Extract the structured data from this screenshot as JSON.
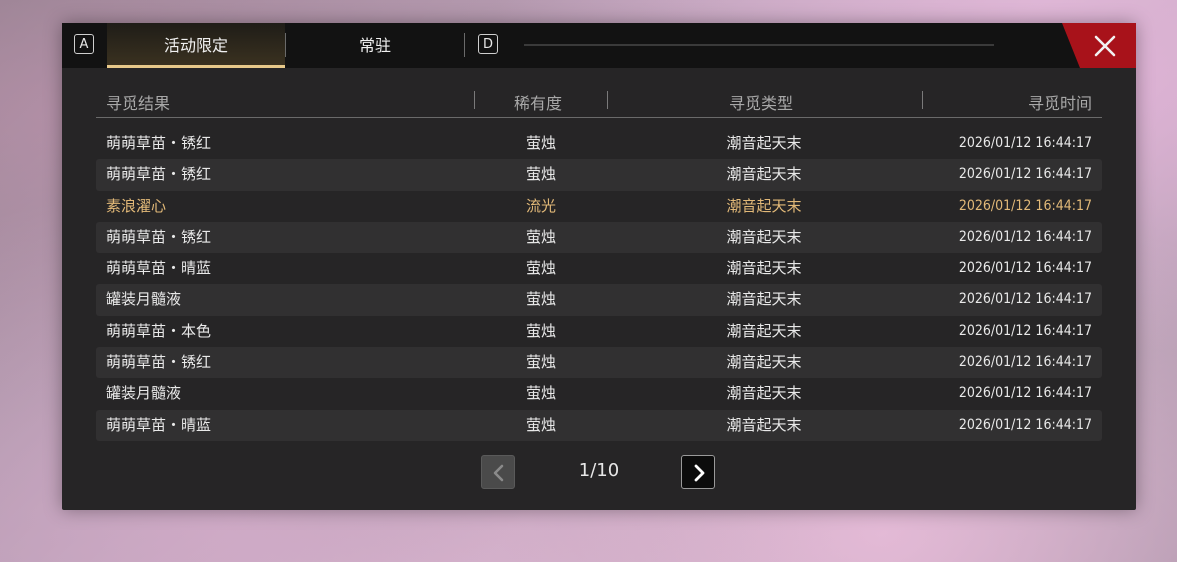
{
  "tabs": {
    "left_key": "A",
    "right_key": "D",
    "items": [
      {
        "label": "活动限定",
        "active": true
      },
      {
        "label": "常驻",
        "active": false
      }
    ]
  },
  "table": {
    "headers": [
      "寻觅结果",
      "稀有度",
      "寻觅类型",
      "寻觅时间"
    ],
    "rows": [
      {
        "result": "萌萌草苗・锈红",
        "rarity": "萤烛",
        "type": "潮音起天末",
        "time": "2026/01/12 16:44:17",
        "highlight": false
      },
      {
        "result": "萌萌草苗・锈红",
        "rarity": "萤烛",
        "type": "潮音起天末",
        "time": "2026/01/12 16:44:17",
        "highlight": false
      },
      {
        "result": "素浪濯心",
        "rarity": "流光",
        "type": "潮音起天末",
        "time": "2026/01/12 16:44:17",
        "highlight": true
      },
      {
        "result": "萌萌草苗・锈红",
        "rarity": "萤烛",
        "type": "潮音起天末",
        "time": "2026/01/12 16:44:17",
        "highlight": false
      },
      {
        "result": "萌萌草苗・晴蓝",
        "rarity": "萤烛",
        "type": "潮音起天末",
        "time": "2026/01/12 16:44:17",
        "highlight": false
      },
      {
        "result": "罐装月髓液",
        "rarity": "萤烛",
        "type": "潮音起天末",
        "time": "2026/01/12 16:44:17",
        "highlight": false
      },
      {
        "result": "萌萌草苗・本色",
        "rarity": "萤烛",
        "type": "潮音起天末",
        "time": "2026/01/12 16:44:17",
        "highlight": false
      },
      {
        "result": "萌萌草苗・锈红",
        "rarity": "萤烛",
        "type": "潮音起天末",
        "time": "2026/01/12 16:44:17",
        "highlight": false
      },
      {
        "result": "罐装月髓液",
        "rarity": "萤烛",
        "type": "潮音起天末",
        "time": "2026/01/12 16:44:17",
        "highlight": false
      },
      {
        "result": "萌萌草苗・晴蓝",
        "rarity": "萤烛",
        "type": "潮音起天末",
        "time": "2026/01/12 16:44:17",
        "highlight": false
      }
    ]
  },
  "pagination": {
    "text": "1/10",
    "prev_icon": "chevron-left-icon",
    "next_icon": "chevron-right-icon"
  },
  "close_icon": "close-icon",
  "colors": {
    "accent_gold": "#e2b978",
    "close_red": "#a8121a",
    "panel_bg": "#262526"
  }
}
